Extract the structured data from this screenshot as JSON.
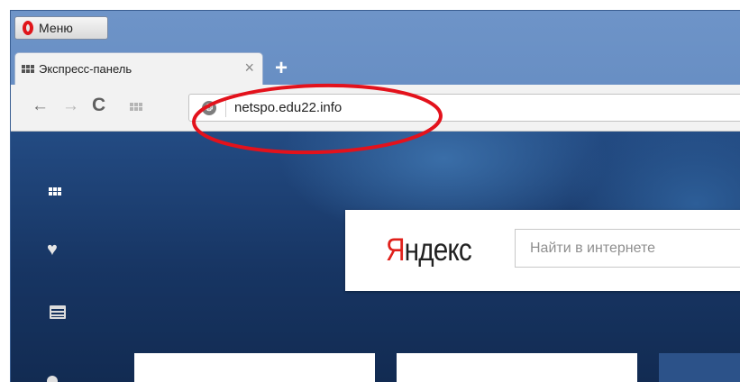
{
  "browser": {
    "menu_label": "Меню",
    "tab_title": "Экспресс-панель",
    "tab_close": "×",
    "new_tab": "+"
  },
  "toolbar": {
    "back_icon": "←",
    "forward_icon": "→",
    "reload_icon": "C",
    "address_value": "netspo.edu22.info",
    "site_icon": "❂"
  },
  "sidebar": {
    "heart_icon": "♥"
  },
  "yandex": {
    "logo_first": "Я",
    "logo_rest": "ндекс",
    "search_placeholder": "Найти в интернете"
  },
  "colors": {
    "annotation": "#e3121c",
    "yandex_red": "#e0201b",
    "page_bg": "#1b3d6f"
  }
}
